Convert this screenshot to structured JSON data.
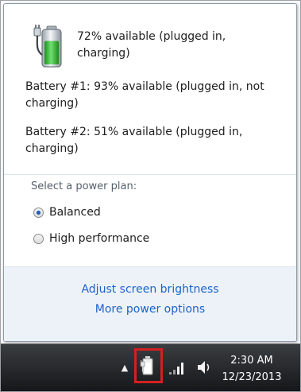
{
  "battery_flyout": {
    "overall_status_line1": "72% available (plugged in,",
    "overall_status_line2": "charging)",
    "battery1_line1": "Battery #1: 93% available (plugged in, not",
    "battery1_line2": "charging)",
    "battery2_line1": "Battery #2: 51% available (plugged in,",
    "battery2_line2": "charging)",
    "battery_icon": "battery-plugged-charging-icon",
    "charge_level": 0.72
  },
  "power_plan": {
    "heading": "Select a power plan:",
    "options": [
      {
        "label": "Balanced",
        "selected": true
      },
      {
        "label": "High performance",
        "selected": false
      }
    ]
  },
  "links": {
    "adjust_brightness": "Adjust screen brightness",
    "more_power_options": "More power options"
  },
  "taskbar": {
    "show_hidden_icons": "▲",
    "tray_icons": [
      "power-icon",
      "network-signal-icon",
      "volume-icon"
    ],
    "clock_time": "2:30 AM",
    "clock_date": "12/23/2013"
  },
  "colors": {
    "link": "#1c64c8",
    "highlight_box": "#d42020",
    "battery_fill": "#3cc83c"
  }
}
